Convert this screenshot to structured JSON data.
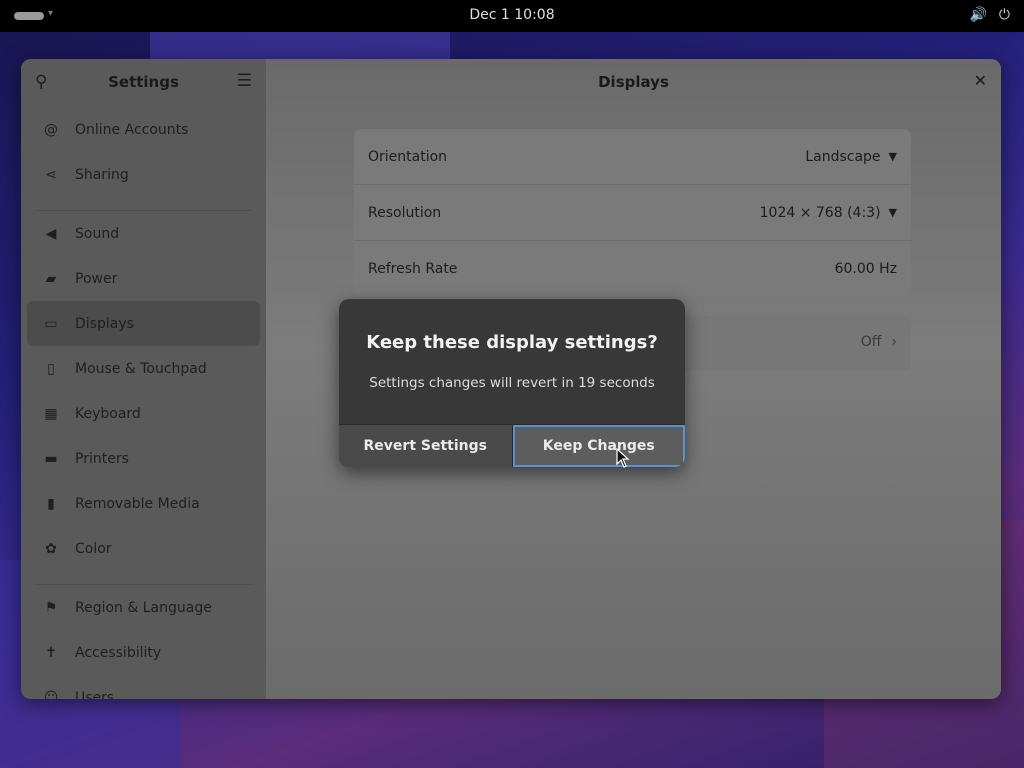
{
  "topbar": {
    "clock": "Dec 1  10:08",
    "volume_icon": "🔊",
    "power_icon": "⏻"
  },
  "sidebar": {
    "title": "Settings",
    "items": [
      {
        "label": "Online Accounts",
        "icon": "@"
      },
      {
        "label": "Sharing",
        "icon": "⋖"
      },
      {
        "label": "Sound",
        "icon": "◀"
      },
      {
        "label": "Power",
        "icon": "▰"
      },
      {
        "label": "Displays",
        "icon": "▭"
      },
      {
        "label": "Mouse & Touchpad",
        "icon": "▯"
      },
      {
        "label": "Keyboard",
        "icon": "▦"
      },
      {
        "label": "Printers",
        "icon": "▬"
      },
      {
        "label": "Removable Media",
        "icon": "▮"
      },
      {
        "label": "Color",
        "icon": "✿"
      },
      {
        "label": "Region & Language",
        "icon": "⚑"
      },
      {
        "label": "Accessibility",
        "icon": "✝"
      },
      {
        "label": "Users",
        "icon": "☺"
      }
    ]
  },
  "main": {
    "title": "Displays",
    "settings": [
      {
        "label": "Orientation",
        "value": "Landscape"
      },
      {
        "label": "Resolution",
        "value": "1024 × 768 (4:3)"
      },
      {
        "label": "Refresh Rate",
        "value": "60.00 Hz"
      }
    ],
    "night_light_value": "Off"
  },
  "dialog": {
    "title": "Keep these display settings?",
    "body": "Settings changes will revert in 19 seconds",
    "revert_label": "Revert Settings",
    "keep_label": "Keep Changes"
  },
  "colors": {
    "accent": "#5b8fd6",
    "dialog_bg": "#383838"
  }
}
